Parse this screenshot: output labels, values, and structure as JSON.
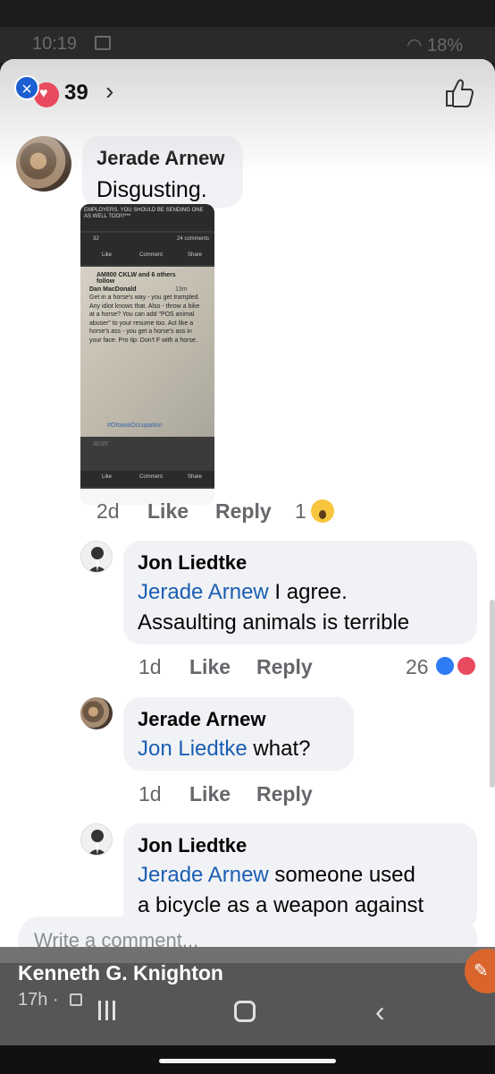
{
  "status_bar": {
    "time": "10:19",
    "battery": "18%"
  },
  "reactions_header": {
    "count": "39",
    "chevron": "›"
  },
  "comments": [
    {
      "name": "Jerade Arnew",
      "text": "Disgusting.",
      "time": "2d",
      "like": "Like",
      "reply": "Reply",
      "reaction_count": "1"
    },
    {
      "name": "Jon Liedtke",
      "mention": "Jerade Arnew",
      "text_line1": " I agree.",
      "text_line2": "Assaulting animals is terrible",
      "time": "1d",
      "like": "Like",
      "reply": "Reply",
      "reaction_count": "26"
    },
    {
      "name": "Jerade Arnew",
      "mention": "Jon Liedtke",
      "text": " what?",
      "time": "1d",
      "like": "Like",
      "reply": "Reply"
    },
    {
      "name": "Jon Liedtke",
      "mention": "Jerade Arnew",
      "text_line1": " someone used",
      "text_line2": "a bicycle as a weapon against"
    }
  ],
  "embedded_screenshot": {
    "top_text": "EMPLOYERS. YOU SHOULD BE SENDING ONE AS WELL TOO!!!***",
    "reactions": "32",
    "comments_count": "24 comments",
    "bar_like": "Like",
    "bar_comment": "Comment",
    "bar_share": "Share",
    "follow": "AM800 CKLW and 6 others follow",
    "author": "Dan MacDonald",
    "time": "13m",
    "body": "Get in a horse's way - you get trampled. Any idiot knows that. Also - throw a bike at a horse? You can add \"POS animal abuser\" to your resume too. Act like a horse's ass - you get a horse's ass in your face. Pro tip: Don't F with a horse.",
    "hashtag": "#OttawaOccupation",
    "brand": "acer"
  },
  "composer": {
    "placeholder": "Write a comment..."
  },
  "overlay": {
    "name": "Kenneth G. Knighton",
    "time": "17h ·"
  }
}
